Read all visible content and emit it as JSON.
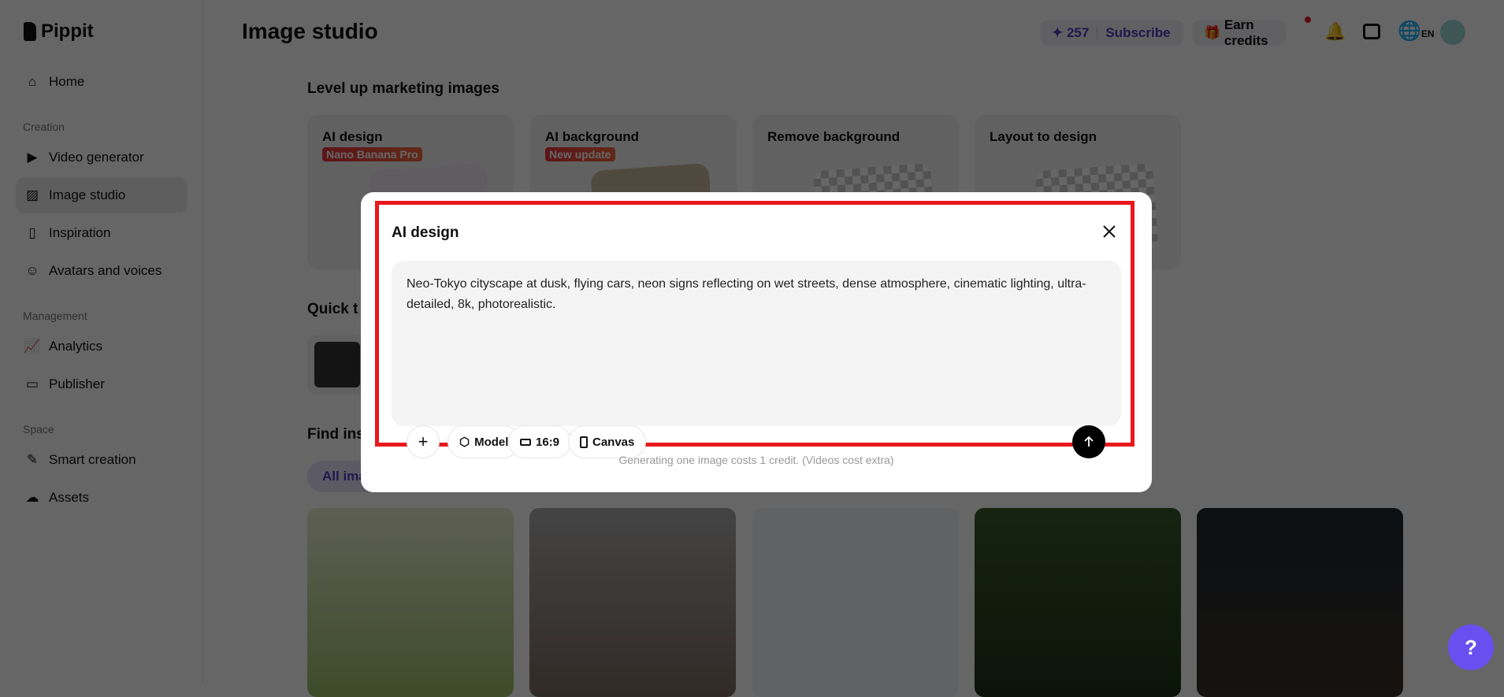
{
  "app": {
    "name": "Pippit",
    "page_title": "Image studio"
  },
  "sidebar": {
    "home": "Home",
    "sections": {
      "creation": "Creation",
      "management": "Management",
      "space": "Space"
    },
    "items": {
      "video_generator": "Video generator",
      "image_studio": "Image studio",
      "inspiration": "Inspiration",
      "avatars": "Avatars and voices",
      "analytics": "Analytics",
      "publisher": "Publisher",
      "smart_creation": "Smart creation",
      "assets": "Assets"
    }
  },
  "header": {
    "credits": "257",
    "subscribe": "Subscribe",
    "earn_credits": "Earn credits",
    "language": "EN"
  },
  "main": {
    "section1": "Level up marketing images",
    "cards": [
      {
        "title": "AI design",
        "badge": "Nano Banana Pro"
      },
      {
        "title": "AI background",
        "badge": "New update"
      },
      {
        "title": "Remove background"
      },
      {
        "title": "Layout to design"
      }
    ],
    "section2": "Quick t",
    "section3": "Find ins",
    "filter": "All ima"
  },
  "modal": {
    "title": "AI design",
    "prompt": "Neo-Tokyo cityscape at dusk, flying cars, neon signs reflecting on wet streets, dense atmosphere, cinematic lighting, ultra-detailed, 8k, photorealistic.",
    "model": "Model",
    "ratio": "16:9",
    "canvas": "Canvas",
    "footer": "Generating one image costs 1 credit. (Videos cost extra)"
  },
  "colors": {
    "accent": "#6a4ff0",
    "highlight": "#e8191c",
    "subscribe": "#4b3bbd"
  }
}
